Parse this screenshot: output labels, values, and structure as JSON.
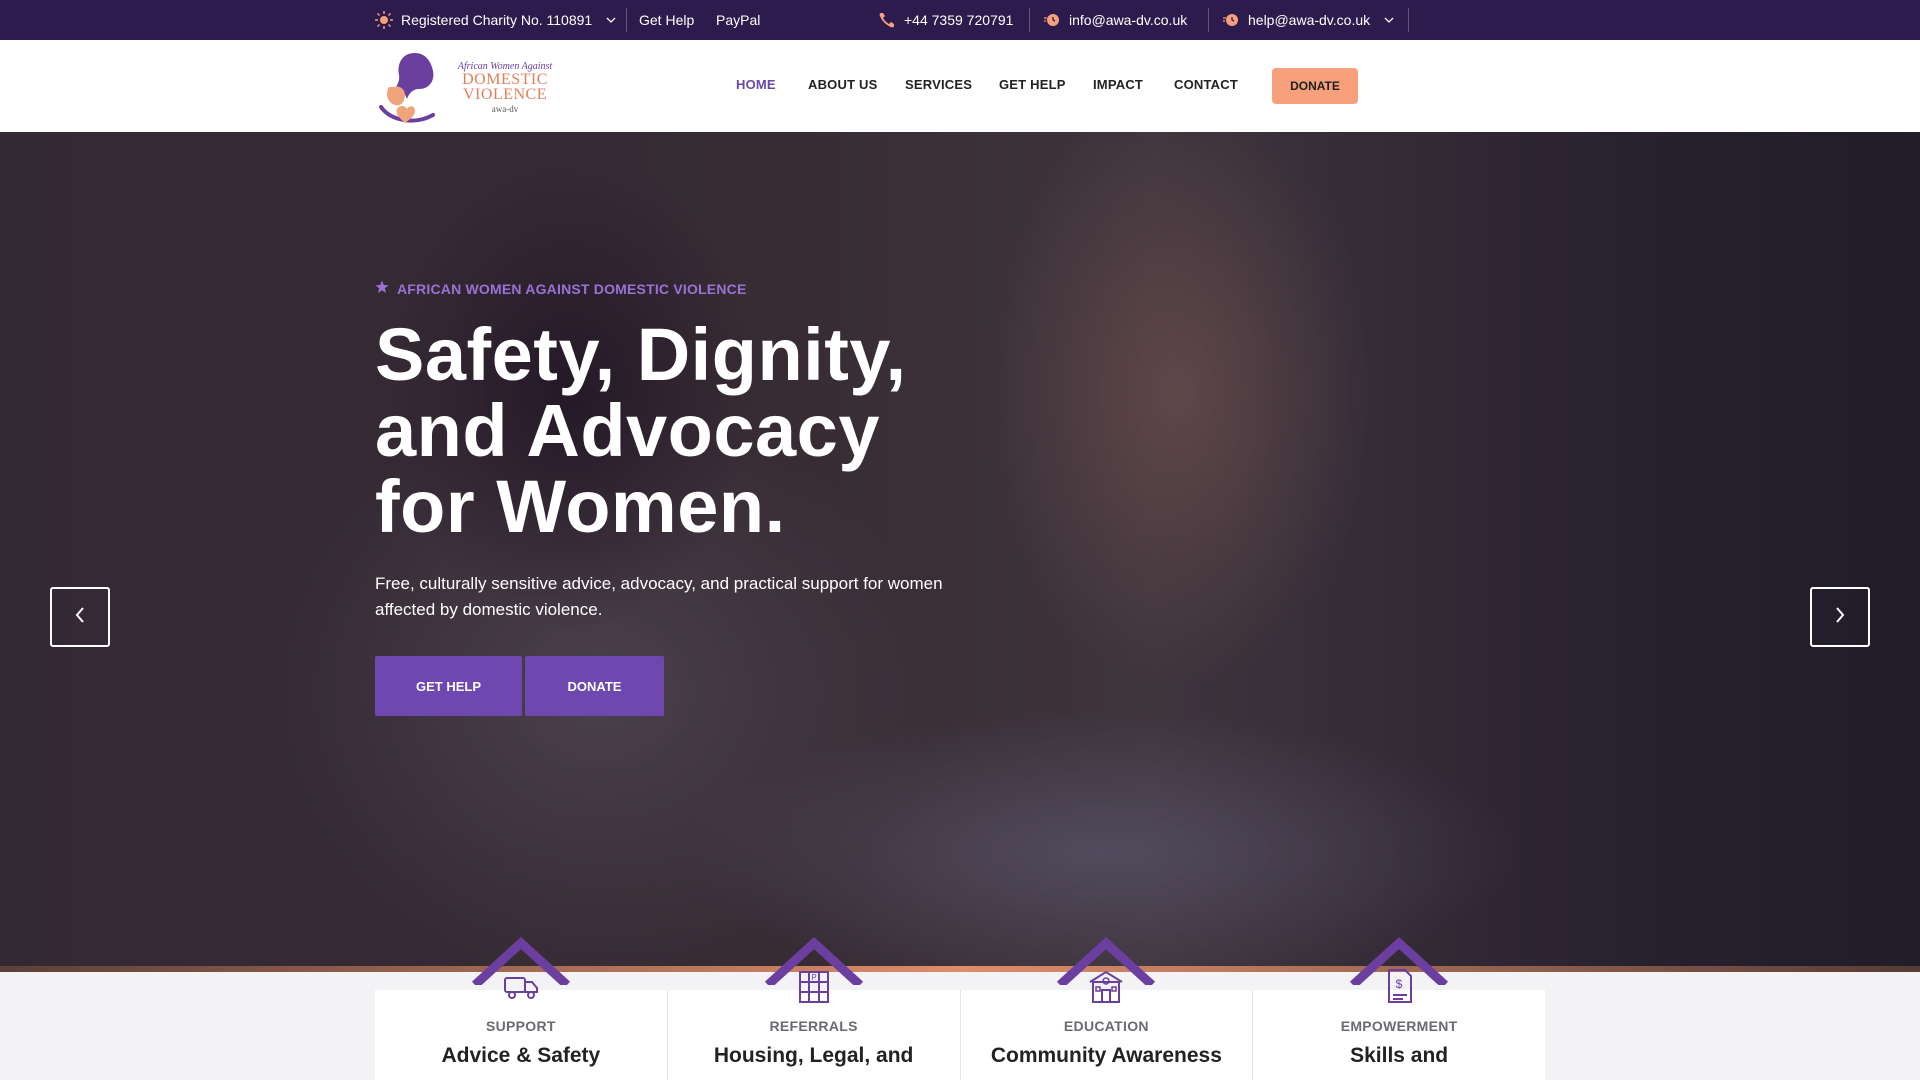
{
  "topbar": {
    "charity": "Registered Charity No. 110891",
    "links": [
      "Get Help",
      "PayPal"
    ],
    "phone": "+44 7359 720791",
    "email_info": "info@awa-dv.co.uk",
    "email_help": "help@awa-dv.co.uk"
  },
  "logo": {
    "line1": "African Women Against",
    "line2a": "DOMESTIC",
    "line2b": "VIOLENCE",
    "line3": "awa-dv"
  },
  "nav": {
    "items": [
      "HOME",
      "ABOUT US",
      "SERVICES",
      "GET HELP",
      "IMPACT",
      "CONTACT"
    ],
    "donate": "DONATE"
  },
  "hero": {
    "eyebrow": "AFRICAN WOMEN AGAINST DOMESTIC VIOLENCE",
    "headline_l1": "Safety, Dignity,",
    "headline_l2": "and Advocacy",
    "headline_l3": "for Women.",
    "lead": "Free, culturally sensitive advice, advocacy, and practical support for women affected by domestic violence.",
    "btn_help": "GET HELP",
    "btn_donate": "DONATE"
  },
  "cards": [
    {
      "eyebrow": "SUPPORT",
      "title": "Advice & Safety",
      "icon": "van-icon"
    },
    {
      "eyebrow": "REFERRALS",
      "title": "Housing, Legal, and",
      "icon": "building-icon"
    },
    {
      "eyebrow": "EDUCATION",
      "title": "Community Awareness",
      "icon": "school-icon"
    },
    {
      "eyebrow": "EMPOWERMENT",
      "title": "Skills and",
      "icon": "document-money-icon"
    }
  ],
  "colors": {
    "topbar": "#2d1b4e",
    "accent_purple": "#6f47b0",
    "donate_orange": "#f7a07b"
  }
}
